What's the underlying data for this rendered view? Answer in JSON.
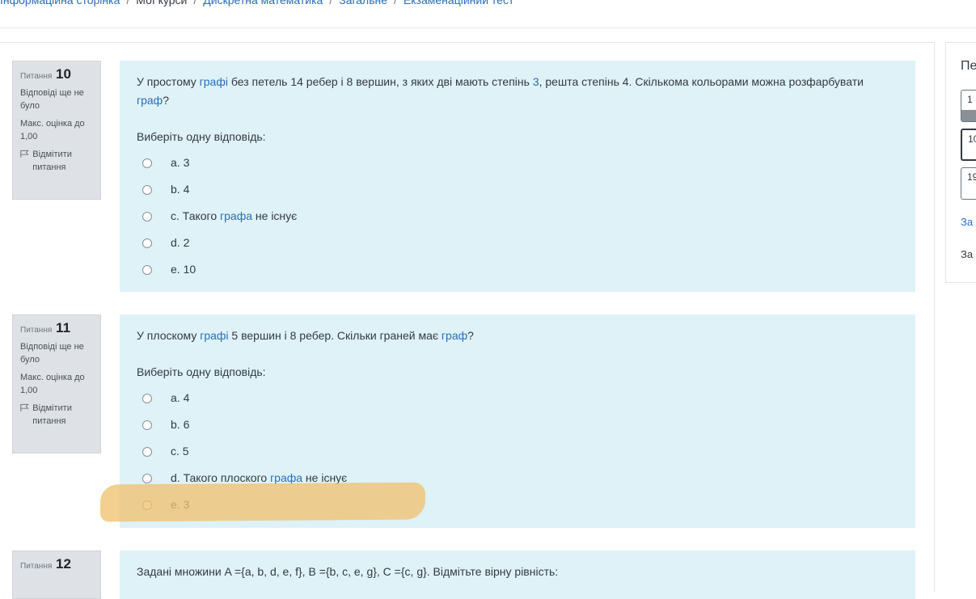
{
  "breadcrumb": {
    "items": [
      "Інформаційна сторінка",
      "Мої курси",
      "Дискретна математика",
      "Загальне",
      "Екзаменаційний тест"
    ],
    "separator": "/"
  },
  "questions": [
    {
      "label": "Питання",
      "number": "10",
      "state": "Відповіді ще не було",
      "grade": "Макс. оцінка до 1,00",
      "flag": "Відмітити питання",
      "text_parts": [
        {
          "t": "У простому "
        },
        {
          "t": "графі",
          "link": true
        },
        {
          "t": " без петель 14 ребер і 8 вершин, з яких дві мають степінь "
        },
        {
          "t": "3",
          "link": true
        },
        {
          "t": ", решта степінь 4. Скількома кольорами можна розфарбувати "
        },
        {
          "t": "граф",
          "link": true
        },
        {
          "t": "?"
        }
      ],
      "prompt": "Виберіть одну відповідь:",
      "options": [
        {
          "parts": [
            {
              "t": "a. 3"
            }
          ]
        },
        {
          "parts": [
            {
              "t": "b. 4"
            }
          ]
        },
        {
          "parts": [
            {
              "t": "c. Такого "
            },
            {
              "t": "графа",
              "link": true
            },
            {
              "t": " не існує"
            }
          ]
        },
        {
          "parts": [
            {
              "t": "d. 2"
            }
          ]
        },
        {
          "parts": [
            {
              "t": "e. 10"
            }
          ]
        }
      ]
    },
    {
      "label": "Питання",
      "number": "11",
      "state": "Відповіді ще не було",
      "grade": "Макс. оцінка до 1,00",
      "flag": "Відмітити питання",
      "text_parts": [
        {
          "t": "У плоскому "
        },
        {
          "t": "графі",
          "link": true
        },
        {
          "t": " 5 вершин і 8 ребер. Скільки граней має "
        },
        {
          "t": "граф",
          "link": true
        },
        {
          "t": "?"
        }
      ],
      "prompt": "Виберіть одну відповідь:",
      "options": [
        {
          "parts": [
            {
              "t": "a. 4"
            }
          ]
        },
        {
          "parts": [
            {
              "t": "b. 6"
            }
          ]
        },
        {
          "parts": [
            {
              "t": "c. 5"
            }
          ]
        },
        {
          "parts": [
            {
              "t": "d. Такого плоского "
            },
            {
              "t": "графа",
              "link": true
            },
            {
              "t": " не існує"
            }
          ]
        },
        {
          "parts": [
            {
              "t": "e. 3"
            }
          ]
        }
      ]
    },
    {
      "label": "Питання",
      "number": "12",
      "text": "Задані множини A ={a, b, d, e, f}, B ={b, c, e, g}, C ={c, g}. Відмітьте вірну рівність:"
    }
  ],
  "nav": {
    "title": "Пе",
    "buttons": [
      "1",
      "10",
      "19"
    ],
    "link": "За",
    "text": "За"
  },
  "colors": {
    "accent": "#2a6ebb",
    "question_bg": "#def2f8",
    "info_bg": "#dee2e6",
    "highlight": "#f0c271"
  }
}
